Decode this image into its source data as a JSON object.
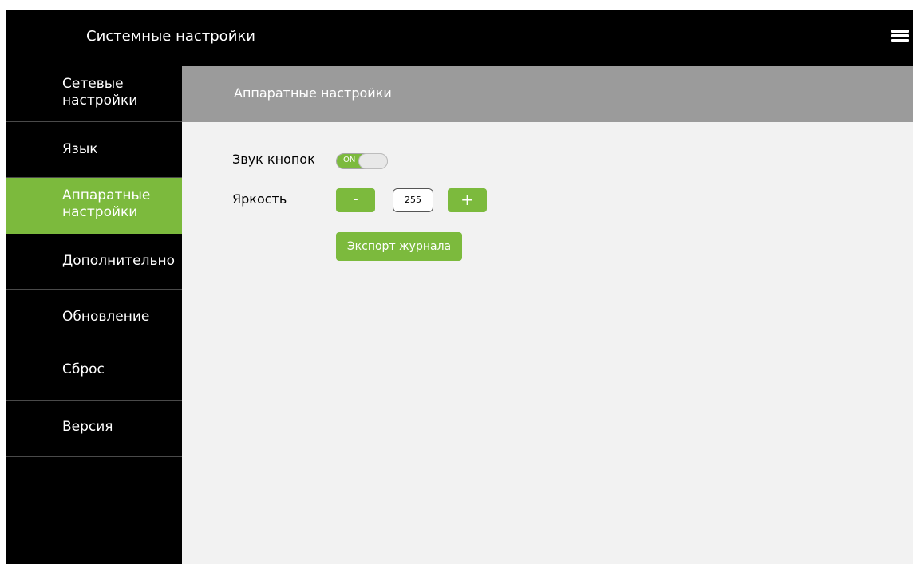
{
  "app": {
    "title": "Системные настройки",
    "menu_icon": "hamburger-menu-icon"
  },
  "sidebar": {
    "items": [
      {
        "label": "Сетевые\nнастройки",
        "active": false
      },
      {
        "label": "Язык",
        "active": false
      },
      {
        "label": "Аппаратные\nнастройки",
        "active": true
      },
      {
        "label": "Дополнительно",
        "active": false
      },
      {
        "label": "Обновление",
        "active": false
      },
      {
        "label": "Сброс",
        "active": false
      },
      {
        "label": "Версия",
        "active": false
      }
    ]
  },
  "content": {
    "title": "Аппаратные настройки",
    "button_sound": {
      "label": "Звук кнопок",
      "toggle_state": "ON"
    },
    "brightness": {
      "label": "Яркость",
      "decrement_label": "-",
      "value": "255",
      "increment_label": "+"
    },
    "export_button_label": "Экспорт журнала"
  },
  "colors": {
    "accent": "#7cba3d",
    "header_gray": "#9b9b9b",
    "background": "#f2f2f2",
    "sidebar": "#000000"
  }
}
